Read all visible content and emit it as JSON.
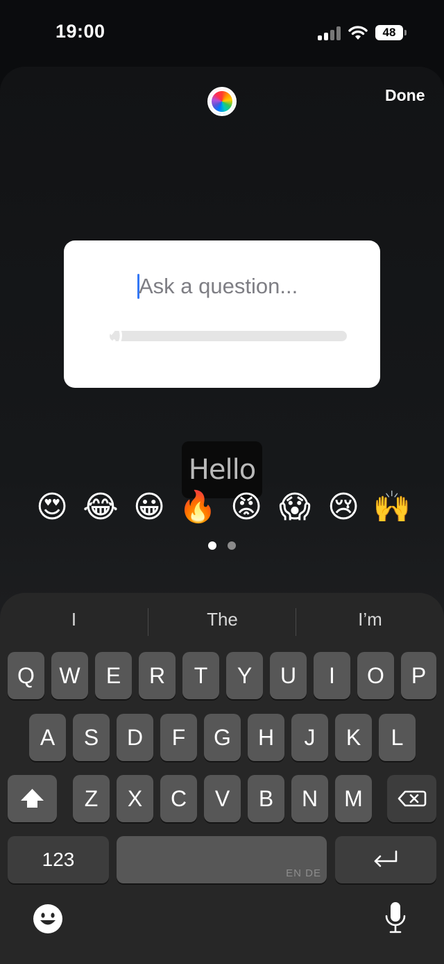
{
  "status_bar": {
    "time": "19:00",
    "battery": "48"
  },
  "header": {
    "done_label": "Done"
  },
  "question_card": {
    "placeholder": "Ask a question...",
    "slider_emoji": "😍"
  },
  "text_tooltip": {
    "text": "Hello"
  },
  "emoji_bar": {
    "items": [
      "😍",
      "😂",
      "😀",
      "🔥",
      "😡",
      "😱",
      "😢",
      "🙌"
    ]
  },
  "pager": {
    "current": 1,
    "total": 2
  },
  "keyboard": {
    "suggestions": [
      "I",
      "The",
      "I’m"
    ],
    "row1": [
      "Q",
      "W",
      "E",
      "R",
      "T",
      "Y",
      "U",
      "I",
      "O",
      "P"
    ],
    "row2": [
      "A",
      "S",
      "D",
      "F",
      "G",
      "H",
      "J",
      "K",
      "L"
    ],
    "row3": [
      "Z",
      "X",
      "C",
      "V",
      "B",
      "N",
      "M"
    ],
    "numbers_label": "123",
    "space_lang": "EN DE"
  },
  "icons": [
    "signal-icon",
    "wifi-icon",
    "battery-icon",
    "color-wheel-icon",
    "shift-icon",
    "backspace-icon",
    "return-icon",
    "emoji-icon",
    "microphone-icon"
  ]
}
